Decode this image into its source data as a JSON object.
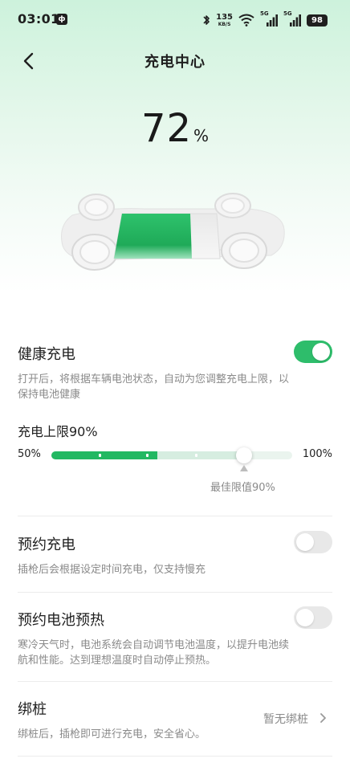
{
  "status_bar": {
    "time": "03:01",
    "app_badge": "ф",
    "net_speed": "135",
    "net_unit": "KB/S",
    "sim1_label": "5G",
    "sim2_label": "5G",
    "battery": "98",
    "icons": [
      "bluetooth-icon",
      "wifi-icon",
      "signal-icon",
      "signal-icon",
      "battery-icon"
    ]
  },
  "header": {
    "title": "充电中心",
    "back_icon": "chevron-left-icon"
  },
  "charge": {
    "percent_value": "72",
    "percent_sign": "%",
    "level_fraction": 0.72
  },
  "healthy_charging": {
    "title": "健康充电",
    "enabled": true,
    "description": "打开后，将根据车辆电池状态，自动为您调整充电上限，以保持电池健康"
  },
  "charge_limit": {
    "title": "充电上限90%",
    "min_label": "50%",
    "max_label": "100%",
    "min": 50,
    "max": 100,
    "value": 90,
    "best_value": 90,
    "best_label": "最佳限值90%"
  },
  "scheduled_charging": {
    "title": "预约充电",
    "enabled": false,
    "description": "插枪后会根据设定时间充电，仅支持慢充"
  },
  "battery_preheat": {
    "title": "预约电池预热",
    "enabled": false,
    "description": "寒冷天气时，电池系统会自动调节电池温度，以提升电池续航和性能。达到理想温度时自动停止预热。"
  },
  "pile_binding": {
    "title": "绑桩",
    "status": "暂无绑桩",
    "description": "绑桩后，插枪即可进行充电，安全省心。"
  },
  "colors": {
    "accent": "#22b862",
    "toggle_on": "#2ebd6b",
    "toggle_off": "#e8e8e8",
    "secondary_text": "#8a8a8a"
  }
}
